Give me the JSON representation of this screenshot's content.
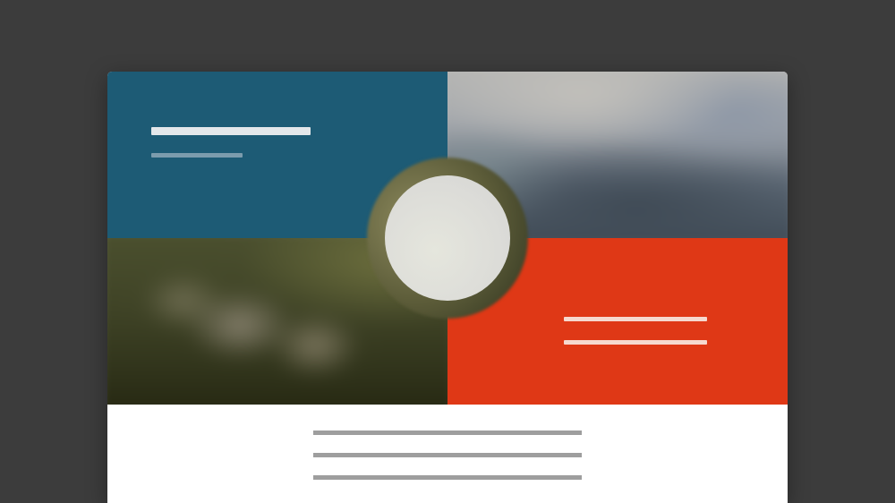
{
  "colors": {
    "desktop_background": "#3c3c3c",
    "panel_blue": "#1d5b75",
    "panel_red": "#df3816",
    "content_background": "#ffffff",
    "placeholder_line": "#9e9e9e"
  },
  "hero": {
    "panels": [
      {
        "position": "top-left",
        "kind": "color",
        "color": "#1d5b75"
      },
      {
        "position": "top-right",
        "kind": "blurred-photo",
        "subject": "mountains"
      },
      {
        "position": "bottom-left",
        "kind": "blurred-photo",
        "subject": "grassy hillside"
      },
      {
        "position": "bottom-right",
        "kind": "color",
        "color": "#df3816"
      }
    ],
    "center_badge": {
      "shape": "circle",
      "color": "#dcdcd8"
    }
  },
  "text_placeholders": {
    "top_left": [
      "title-bar",
      "subtitle-bar"
    ],
    "bottom_right": [
      "text-bar",
      "text-bar"
    ],
    "content": [
      "text-line",
      "text-line",
      "text-line"
    ]
  }
}
